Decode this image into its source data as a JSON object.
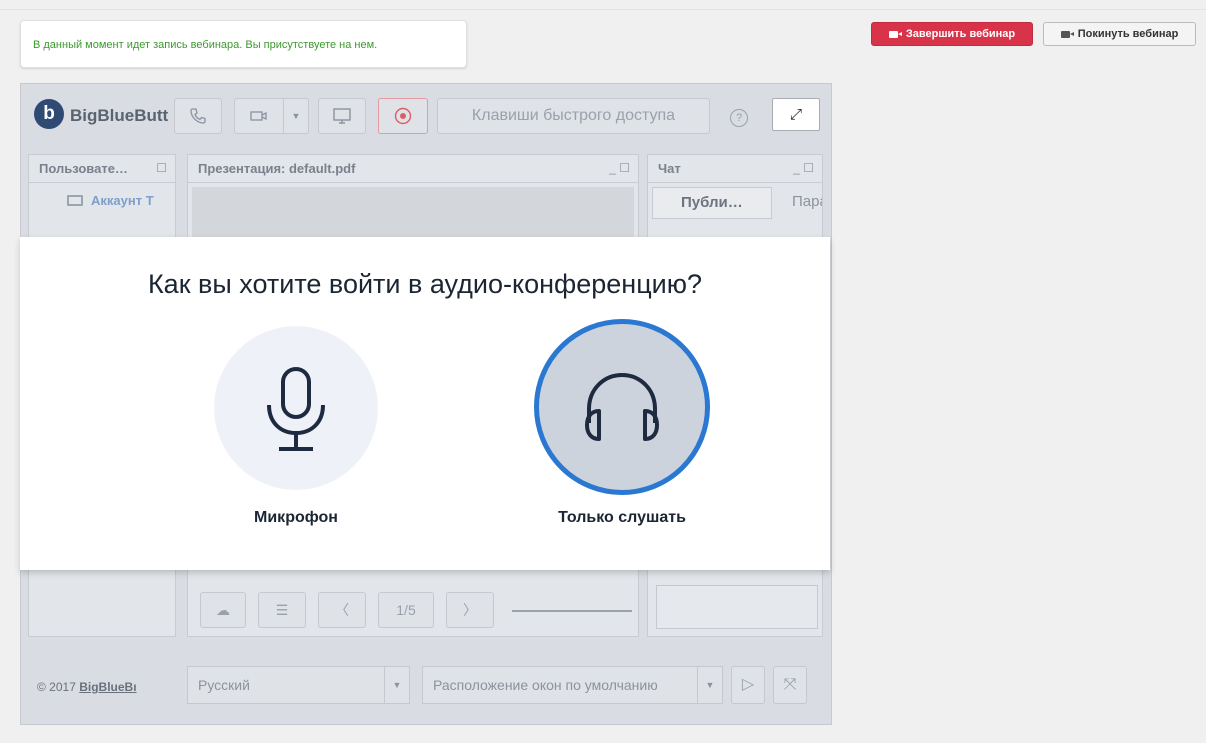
{
  "notice": {
    "text": "В данный момент идет запись вебинара. Вы присутствуете на нем."
  },
  "top_buttons": {
    "end_label": "Завершить вебинар",
    "leave_label": "Покинуть вебинар"
  },
  "colors": {
    "end_button": "#d9334a",
    "notice_text": "#3c9a2e",
    "listen_ring": "#2a78d1",
    "logo": "#2f4a73"
  },
  "bbb": {
    "logo_text": "BigBlueButt",
    "logo_letter": "b",
    "shortcuts_label": "Клавиши быстрого доступа",
    "help_glyph": "?",
    "icons": [
      "phone-icon",
      "camera-icon",
      "dropdown-icon",
      "screen-share-icon",
      "record-icon",
      "help-icon",
      "fullscreen-icon"
    ],
    "panels": {
      "users_title": "Пользовате…",
      "user_name": "Аккаунт Т",
      "presentation_title": "Презентация: default.pdf",
      "chat_title": "Чат",
      "chat_tab_public": "Публи…",
      "chat_tab_options": "Пара"
    },
    "presentation_controls": {
      "page": "1/5"
    },
    "footer": {
      "copyright": "© 2017",
      "copyright_link": "BigBlueBı",
      "language": "Русский",
      "layout": "Расположение окон по умолчанию"
    }
  },
  "modal": {
    "title": "Как вы хотите войти в аудио-конференцию?",
    "options": [
      {
        "label": "Микрофон",
        "icon": "microphone-icon"
      },
      {
        "label": "Только слушать",
        "icon": "headphones-icon"
      }
    ]
  }
}
